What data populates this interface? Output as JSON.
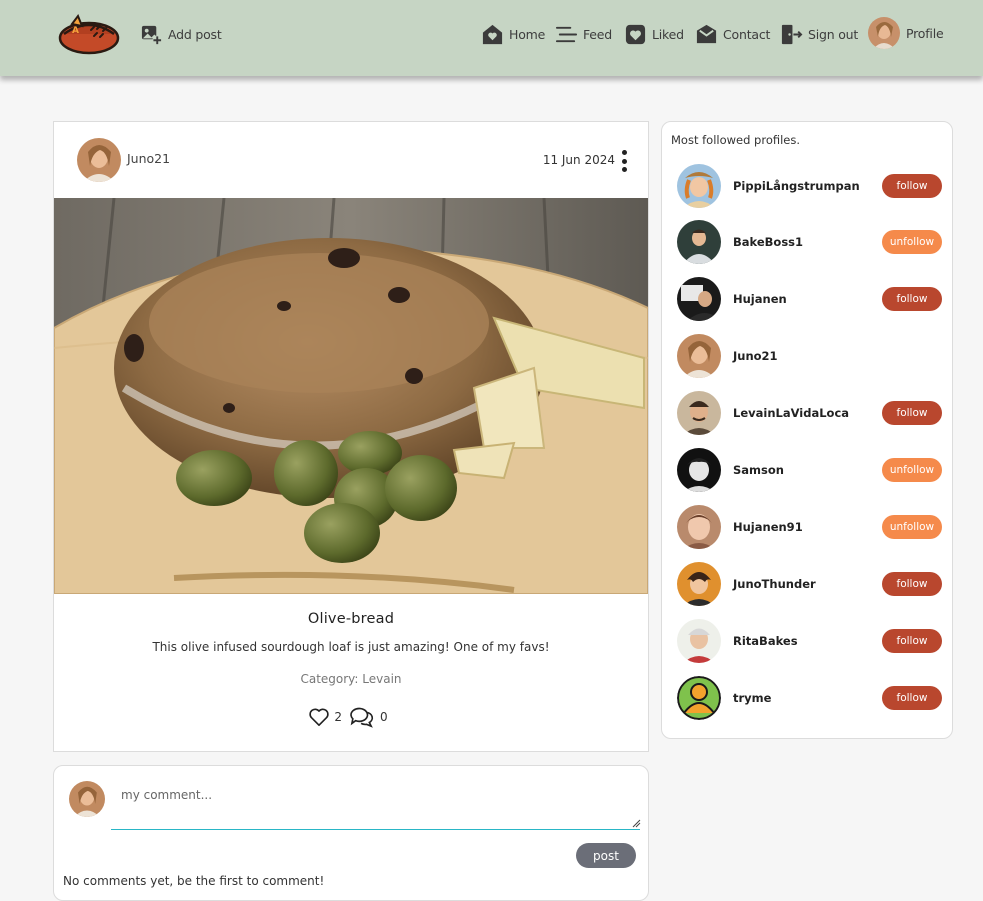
{
  "colors": {
    "navbar_bg": "#c6d5c4",
    "follow": "#b9472e",
    "unfollow": "#f58a4b",
    "post_button": "#6b6e78",
    "input_underline": "#29b6c6"
  },
  "nav": {
    "add_post": "Add post",
    "home": "Home",
    "feed": "Feed",
    "liked": "Liked",
    "contact": "Contact",
    "sign_out": "Sign out",
    "profile": "Profile"
  },
  "post": {
    "author": "Juno21",
    "date": "11 Jun 2024",
    "title": "Olive-bread",
    "description": "This olive infused sourdough loaf is just amazing! One of my favs!",
    "category": "Category: Levain",
    "likes": "2",
    "comments": "0"
  },
  "comment_form": {
    "placeholder": "my comment...",
    "post_label": "post",
    "empty_text": "No comments yet, be the first to comment!"
  },
  "sidebar": {
    "title": "Most followed profiles.",
    "profiles": [
      {
        "name": "PippiLångstrumpan",
        "button": "follow"
      },
      {
        "name": "BakeBoss1",
        "button": "unfollow"
      },
      {
        "name": "Hujanen",
        "button": "follow"
      },
      {
        "name": "Juno21",
        "button": ""
      },
      {
        "name": "LevainLaVidaLoca",
        "button": "follow"
      },
      {
        "name": "Samson",
        "button": "unfollow"
      },
      {
        "name": "Hujanen91",
        "button": "unfollow"
      },
      {
        "name": "JunoThunder",
        "button": "follow"
      },
      {
        "name": "RitaBakes",
        "button": "follow"
      },
      {
        "name": "tryme",
        "button": "follow"
      }
    ]
  }
}
